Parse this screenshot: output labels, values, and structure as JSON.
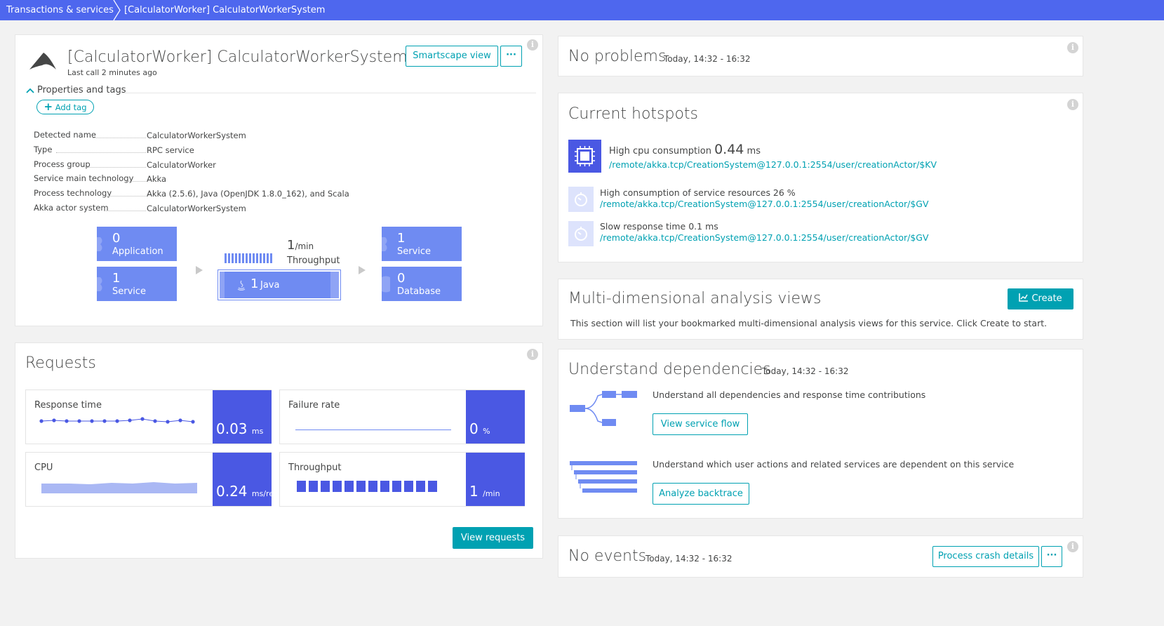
{
  "breadcrumb": {
    "items": [
      "Transactions & services",
      "[CalculatorWorker] CalculatorWorkerSystem"
    ]
  },
  "service": {
    "title": "[CalculatorWorker] CalculatorWorkerSystem",
    "last_call": "Last call 2 minutes ago",
    "smartscape_label": "Smartscape view",
    "more_label": "···",
    "properties_toggle": "Properties and tags",
    "add_tag_label": "Add tag",
    "properties": [
      {
        "label": "Detected name",
        "value": "CalculatorWorkerSystem",
        "link": false
      },
      {
        "label": "Type",
        "value": "RPC service",
        "link": false
      },
      {
        "label": "Process group",
        "value": "CalculatorWorker",
        "link": true
      },
      {
        "label": "Service main technology",
        "value": "Akka",
        "link": false
      },
      {
        "label": "Process technology",
        "value": "Akka (2.5.6), Java (OpenJDK 1.8.0_162), and Scala",
        "link": false
      },
      {
        "label": "Akka actor system",
        "value": "CalculatorWorkerSystem",
        "link": false
      }
    ],
    "flow": {
      "callers": [
        {
          "count": "0",
          "label": "Application"
        },
        {
          "count": "1",
          "label": "Service"
        }
      ],
      "throughput_value": "1",
      "throughput_unit": "/min",
      "throughput_label": "Throughput",
      "process_count": "1",
      "process_label": "Java",
      "callees": [
        {
          "count": "1",
          "label": "Service"
        },
        {
          "count": "0",
          "label": "Database"
        }
      ]
    }
  },
  "requests": {
    "title": "Requests",
    "tiles": [
      {
        "label": "Response time",
        "value": "0.03",
        "unit": "ms"
      },
      {
        "label": "Failure rate",
        "value": "0",
        "unit": "%"
      },
      {
        "label": "CPU",
        "value": "0.24",
        "unit": "ms/req"
      },
      {
        "label": "Throughput",
        "value": "1",
        "unit": "/min"
      }
    ],
    "view_requests_label": "View requests"
  },
  "problems": {
    "title": "No problems",
    "timeframe": "Today, 14:32 - 16:32"
  },
  "hotspots": {
    "title": "Current hotspots",
    "items": [
      {
        "title": "High cpu consumption",
        "value": "0.44",
        "unit": "ms",
        "link": "/remote/akka.tcp/CreationSystem@127.0.0.1:2554/user/creationActor/$KV",
        "icon": "cpu-icon"
      },
      {
        "title": "High consumption of service resources 26 %",
        "link": "/remote/akka.tcp/CreationSystem@127.0.0.1:2554/user/creationActor/$GV",
        "icon": "stopwatch-icon"
      },
      {
        "title": "Slow response time 0.1 ms",
        "link": "/remote/akka.tcp/CreationSystem@127.0.0.1:2554/user/creationActor/$GV",
        "icon": "stopwatch-icon"
      }
    ]
  },
  "mda": {
    "title": "Multi-dimensional analysis views",
    "create_label": "Create",
    "description": "This section will list your bookmarked multi-dimensional analysis views for this service. Click Create to start."
  },
  "dependencies": {
    "title": "Understand dependencies",
    "timeframe": "Today, 14:32 - 16:32",
    "flow_text": "Understand all dependencies and response time contributions",
    "flow_button": "View service flow",
    "backtrace_text": "Understand which user actions and related services are dependent on this service",
    "backtrace_button": "Analyze backtrace"
  },
  "events": {
    "title": "No events",
    "timeframe": "Today, 14:32 - 16:32",
    "crash_button": "Process crash details",
    "more_label": "···"
  },
  "colors": {
    "topbar": "#4e67ee",
    "accent": "#00a1b2",
    "tile_value": "#4a58e3",
    "flow_box": "#6f8bf2"
  }
}
